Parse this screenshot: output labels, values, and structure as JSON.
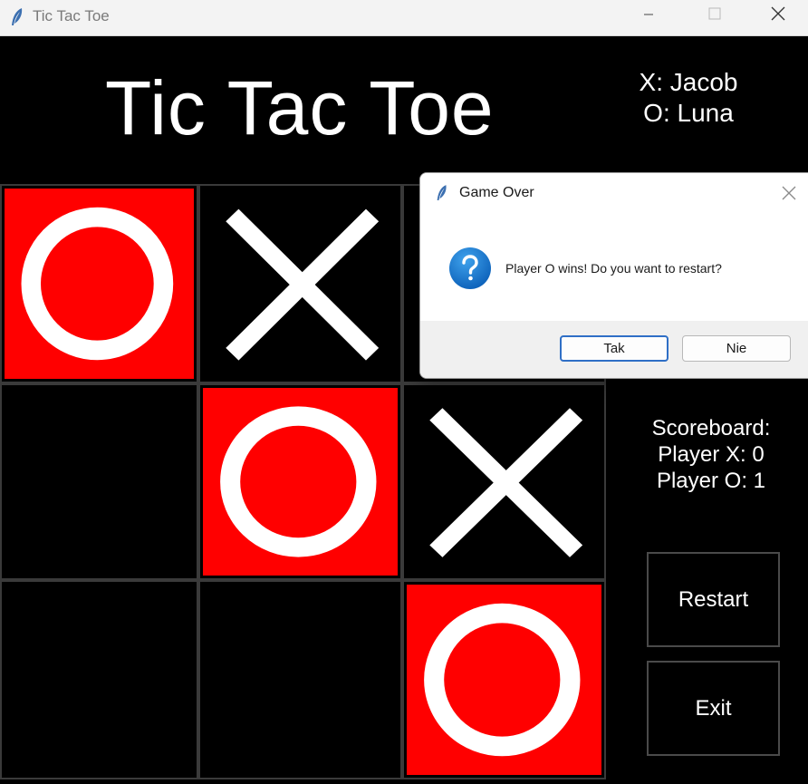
{
  "window": {
    "title": "Tic Tac Toe"
  },
  "header": {
    "title": "Tic Tac Toe",
    "player_x": "X: Jacob",
    "player_o": "O: Luna"
  },
  "board": {
    "cells": [
      "O",
      "X",
      "",
      "",
      "O",
      "X",
      "",
      "",
      "O"
    ]
  },
  "scoreboard": {
    "heading": "Scoreboard:",
    "player_x": "Player X: 0",
    "player_o": "Player O: 1"
  },
  "buttons": {
    "restart": "Restart",
    "exit": "Exit"
  },
  "dialog": {
    "title": "Game Over",
    "message": "Player O wins! Do you want to restart?",
    "yes_label": "Tak",
    "no_label": "Nie",
    "icon": "question-icon"
  },
  "colors": {
    "o_fill": "#ff0000",
    "mark": "#ffffff",
    "background": "#000000",
    "accent": "#2f6fc6"
  }
}
